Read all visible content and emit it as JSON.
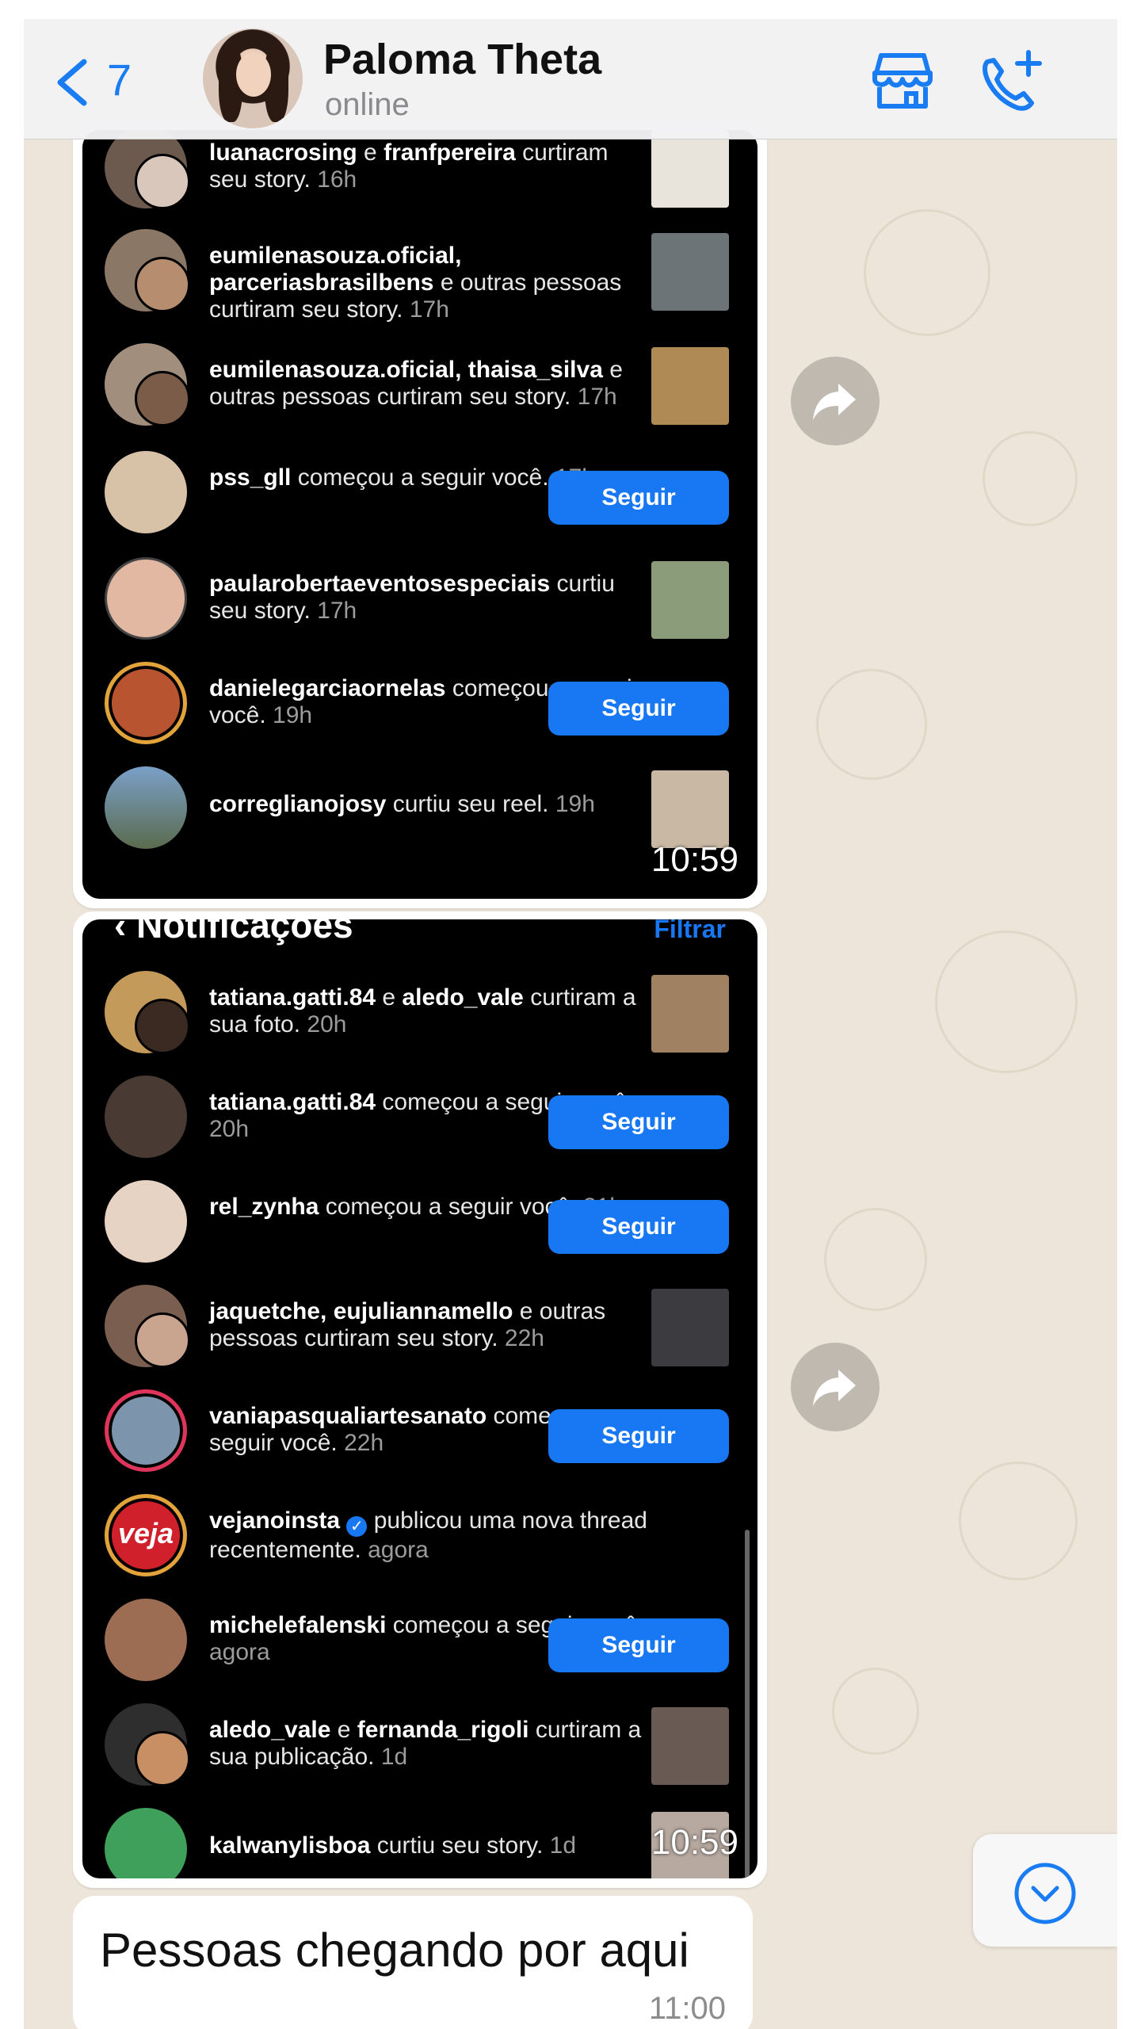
{
  "header": {
    "back_count": "7",
    "contact_name": "Paloma Theta",
    "status": "online",
    "icons": [
      "back-chevron-icon",
      "store-icon",
      "add-call-icon"
    ],
    "accent_color": "#1a7cf2"
  },
  "screenshot1": {
    "time": "10:59",
    "items": [
      {
        "user": "luanacrosing",
        "rest1": " e ",
        "user2": "franfpereira",
        "text": " curtiram seu story.",
        "ago": " 16h"
      },
      {
        "user": "eumilenasouza.oficial,",
        "user2": "parceriasbrasilbens",
        "text": " e outras pessoas curtiram seu story.",
        "ago": " 17h"
      },
      {
        "user": "eumilenasouza.oficial,",
        "user2": " thaisa_silva",
        "text": " e outras pessoas curtiram seu story.",
        "ago": " 17h"
      },
      {
        "user": "pss_gll",
        "text": " começou a seguir você.",
        "ago": " 17h",
        "button": "Seguir"
      },
      {
        "user": "paularobertaeventosespeciais",
        "text": " curtiu seu story.",
        "ago": " 17h"
      },
      {
        "user": "danielegarciaornelas",
        "text": " começou a seguir você.",
        "ago": " 19h",
        "button": "Seguir"
      },
      {
        "user": "correglianojosy",
        "text": " curtiu seu reel.",
        "ago": " 19h"
      }
    ]
  },
  "screenshot2": {
    "time": "10:59",
    "title": "Notificações",
    "filter": "Filtrar",
    "items": [
      {
        "user": "tatiana.gatti.84",
        "rest1": " e ",
        "user2": "aledo_vale",
        "text": " curtiram a sua foto.",
        "ago": " 20h"
      },
      {
        "user": "tatiana.gatti.84",
        "text": " começou a seguir você.",
        "ago": " 20h",
        "button": "Seguir"
      },
      {
        "user": "rel_zynha",
        "text": " começou a seguir você.",
        "ago": " 21h",
        "button": "Seguir"
      },
      {
        "user": "jaquetche, eujuliannamello",
        "text": " e outras pessoas curtiram seu story.",
        "ago": " 22h"
      },
      {
        "user": "vaniapasqualiartesanato",
        "text": " começou a seguir você.",
        "ago": " 22h",
        "button": "Seguir"
      },
      {
        "user": "vejanoinsta",
        "text": " publicou uma nova thread recentemente.",
        "ago": " agora",
        "verified": true,
        "avatar_text": "veja"
      },
      {
        "user": "michelefalenski",
        "text": " começou a seguir você.",
        "ago": " agora",
        "button": "Seguir"
      },
      {
        "user": "aledo_vale",
        "rest1": " e ",
        "user2": "fernanda_rigoli",
        "text": " curtiram a sua publicação.",
        "ago": " 1d"
      },
      {
        "user": "kalwanylisboa",
        "text": " curtiu seu story.",
        "ago": " 1d"
      }
    ]
  },
  "message": {
    "text": "Pessoas chegando por aqui",
    "time": "11:00"
  }
}
